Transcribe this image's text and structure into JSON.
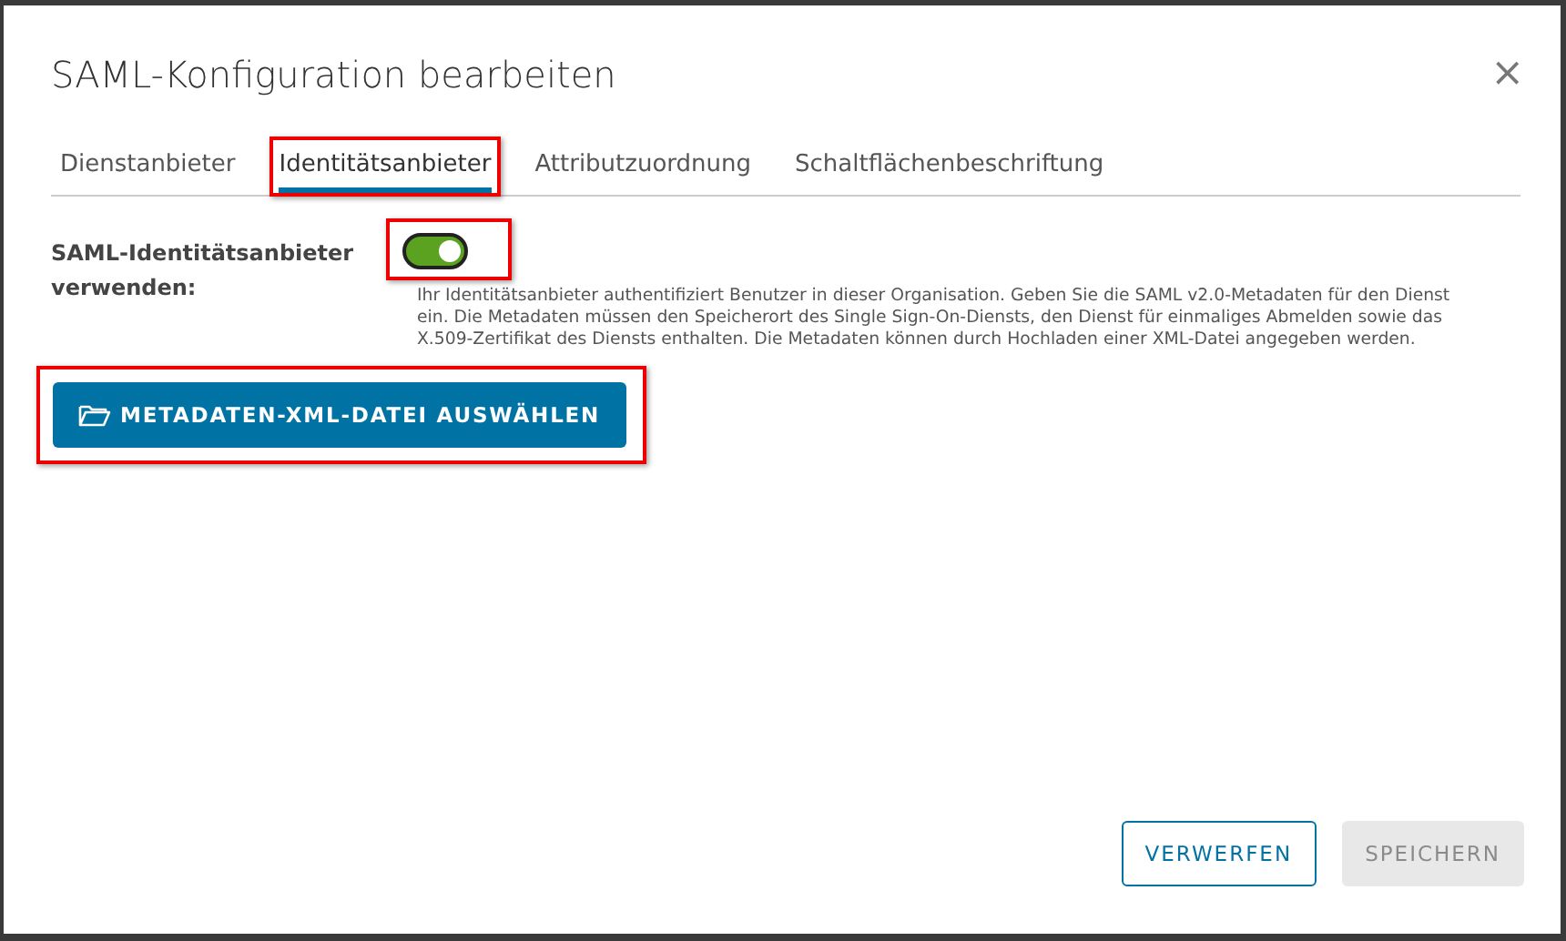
{
  "dialog": {
    "title": "SAML-Konfiguration bearbeiten",
    "close": "×"
  },
  "tabs": [
    {
      "label": "Dienstanbieter",
      "selected": false,
      "highlighted": false
    },
    {
      "label": "Identitätsanbieter",
      "selected": true,
      "highlighted": true
    },
    {
      "label": "Attributzuordnung",
      "selected": false,
      "highlighted": false
    },
    {
      "label": "Schaltflächenbeschriftung",
      "selected": false,
      "highlighted": false
    }
  ],
  "setting": {
    "label": "SAML-Identitätsanbieter verwenden:",
    "on": true,
    "highlighted": true,
    "help": "Ihr Identitätsanbieter authentifiziert Benutzer in dieser Organisation. Geben Sie die SAML v2.0-Metadaten für den Dienst ein. Die Metadaten müssen den Speicherort des Single Sign-On-Diensts, den Dienst für einmaliges Abmelden sowie das X.509-Zertifikat des Diensts enthalten. Die Metadaten können durch Hochladen einer XML-Datei angegeben werden."
  },
  "upload_button": {
    "label": "METADATEN-XML-DATEI AUSWÄHLEN",
    "highlighted": true
  },
  "buttons": [
    {
      "label": "VERWERFEN",
      "disabled": false
    },
    {
      "label": "SPEICHERN",
      "disabled": true
    }
  ]
}
